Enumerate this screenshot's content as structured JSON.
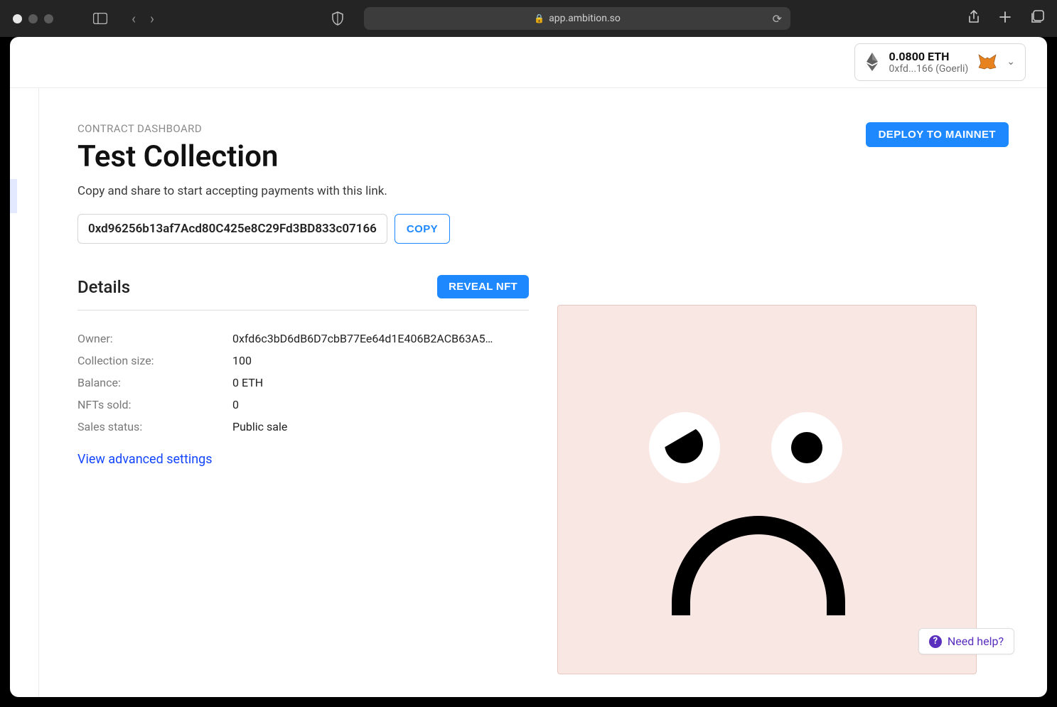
{
  "browser": {
    "url": "app.ambition.so"
  },
  "wallet": {
    "balance": "0.0800 ETH",
    "address_short": "0xfd...166 (Goerli)"
  },
  "header": {
    "breadcrumb": "CONTRACT DASHBOARD",
    "title": "Test Collection",
    "subtitle": "Copy and share to start accepting payments with this link.",
    "deploy_label": "DEPLOY TO MAINNET"
  },
  "contract": {
    "address": "0xd96256b13af7Acd80C425e8C29Fd3BD833c07166",
    "copy_label": "COPY"
  },
  "details": {
    "heading": "Details",
    "reveal_label": "REVEAL NFT",
    "rows": [
      {
        "label": "Owner:",
        "value": "0xfd6c3bD6dB6D7cbB77Ee64d1E406B2ACB63A5…"
      },
      {
        "label": "Collection size:",
        "value": "100"
      },
      {
        "label": "Balance:",
        "value": "0 ETH"
      },
      {
        "label": "NFTs sold:",
        "value": "0"
      },
      {
        "label": "Sales status:",
        "value": "Public sale"
      }
    ],
    "advanced_link": "View advanced settings"
  },
  "help": {
    "label": "Need help?"
  }
}
